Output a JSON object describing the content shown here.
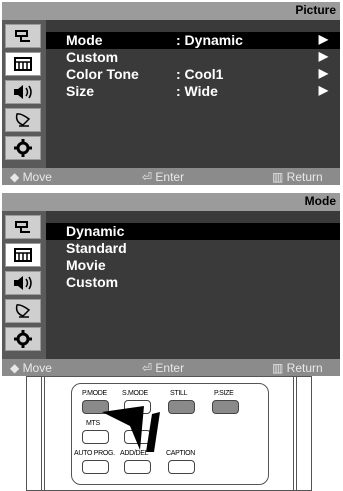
{
  "panel1": {
    "title": "Picture",
    "rows": [
      {
        "label": "Mode",
        "value": ": Dynamic",
        "arrow": "▶"
      },
      {
        "label": "Custom",
        "value": "",
        "arrow": "▶"
      },
      {
        "label": "Color Tone",
        "value": ": Cool1",
        "arrow": "▶"
      },
      {
        "label": "Size",
        "value": ": Wide",
        "arrow": "▶"
      }
    ],
    "footer": {
      "move": "◆ Move",
      "enter": "⏎ Enter",
      "ret": "Return"
    }
  },
  "panel2": {
    "title": "Mode",
    "rows": [
      {
        "label": "Dynamic"
      },
      {
        "label": "Standard"
      },
      {
        "label": "Movie"
      },
      {
        "label": "Custom"
      }
    ],
    "footer": {
      "move": "◆ Move",
      "enter": "⏎ Enter",
      "ret": "Return"
    }
  },
  "remote": {
    "buttons": {
      "pmode": "P.MODE",
      "smode": "S.MODE",
      "still": "STILL",
      "psize": "P.SIZE",
      "mts": "MTS",
      "autoprog": "AUTO PROG.",
      "adddel": "ADD/DEL",
      "caption": "CAPTION"
    }
  },
  "icons": [
    "input-icon",
    "picture-icon",
    "sound-icon",
    "channel-icon",
    "setup-icon"
  ],
  "colors": {
    "panel_bg": "#3a3a3a",
    "title_bg": "#9b9b9b",
    "highlight": "#000000",
    "text": "#ffffff",
    "footer": "#8b8b8b"
  }
}
